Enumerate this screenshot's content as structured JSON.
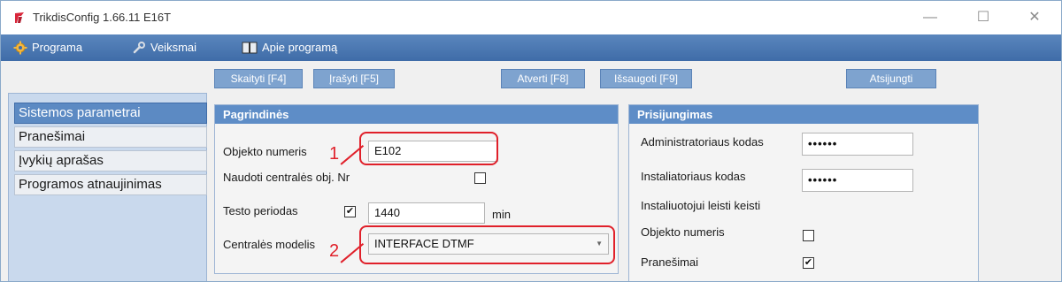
{
  "window": {
    "title": "TrikdisConfig 1.66.11   E16T"
  },
  "menu": {
    "items": [
      {
        "label": "Programa",
        "icon": "gear-icon"
      },
      {
        "label": "Veiksmai",
        "icon": "wrench-icon"
      },
      {
        "label": "Apie programą",
        "icon": "book-icon"
      }
    ]
  },
  "toolbar": {
    "read": "Skaityti [F4]",
    "write": "Įrašyti [F5]",
    "open": "Atverti [F8]",
    "save": "Išsaugoti [F9]",
    "disconnect": "Atsijungti"
  },
  "sidebar": {
    "items": [
      {
        "label": "Sistemos parametrai",
        "active": true
      },
      {
        "label": "Pranešimai",
        "active": false
      },
      {
        "label": "Įvykių aprašas",
        "active": false
      },
      {
        "label": "Programos atnaujinimas",
        "active": false
      }
    ]
  },
  "main_group": {
    "title": "Pagrindinės",
    "object_number_label": "Objekto numeris",
    "object_number_value": "E102",
    "use_central_label": "Naudoti centralės obj. Nr",
    "use_central_checked": false,
    "test_period_label": "Testo periodas",
    "test_period_checked": true,
    "test_period_value": "1440",
    "test_period_unit": "min",
    "central_model_label": "Centralės modelis",
    "central_model_value": "INTERFACE DTMF"
  },
  "login_group": {
    "title": "Prisijungimas",
    "admin_code_label": "Administratoriaus kodas",
    "admin_code_value": "••••••",
    "installer_code_label": "Instaliatoriaus kodas",
    "installer_code_value": "••••••",
    "installer_allowed_label": "Instaliuotojui leisti keisti",
    "object_number_label": "Objekto numeris",
    "object_number_checked": false,
    "messages_label": "Pranešimai",
    "messages_checked": true
  },
  "annotations": {
    "marker1": "1",
    "marker2": "2"
  },
  "colors": {
    "accent": "#5e8dc7",
    "highlight": "#e0202a"
  }
}
